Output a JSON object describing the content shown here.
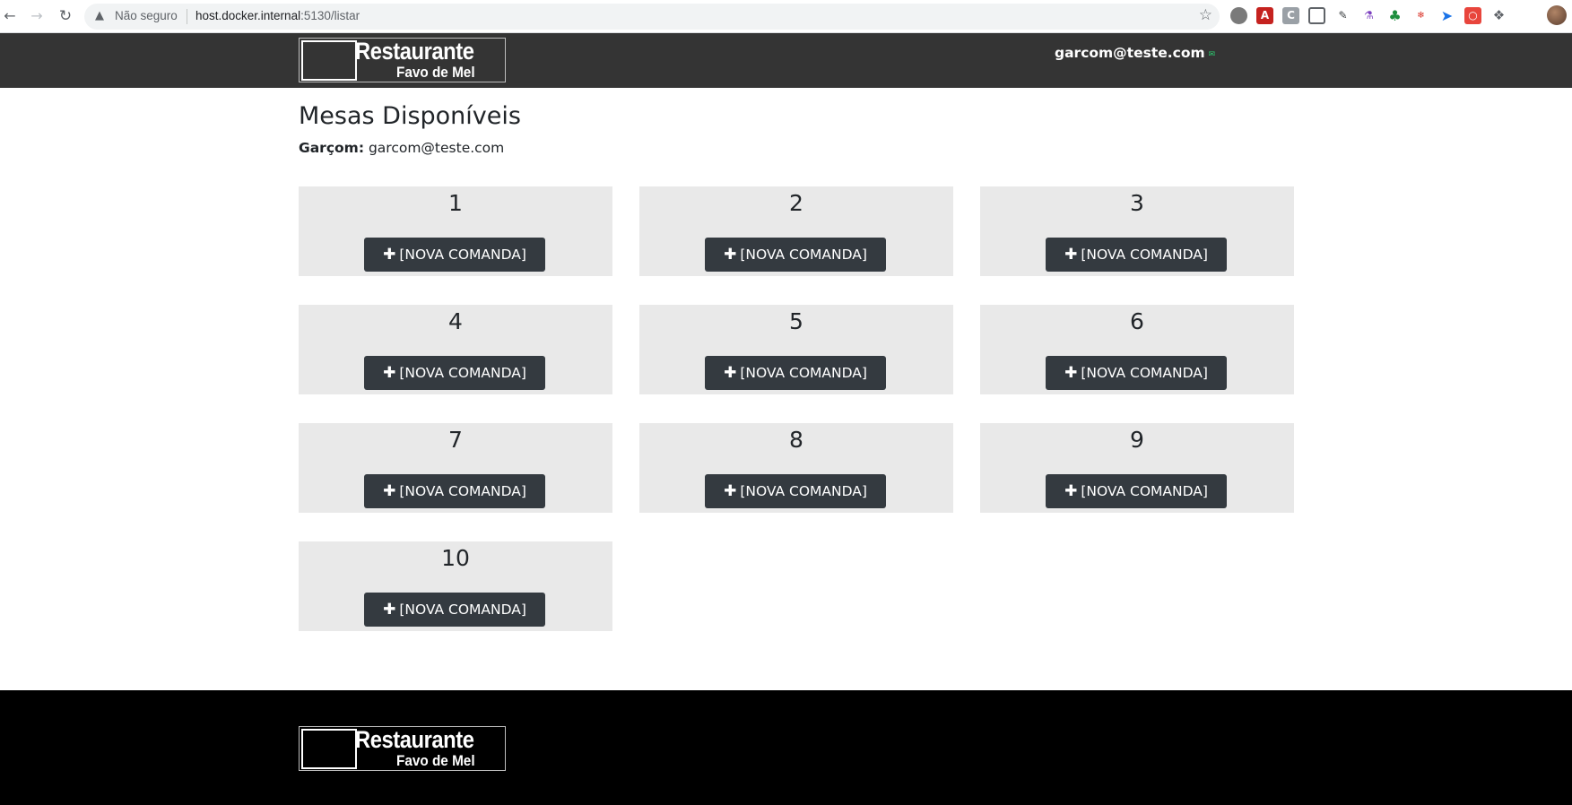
{
  "browser": {
    "nav_back_icon": "arrow-left-icon",
    "nav_forward_icon": "arrow-right-icon",
    "reload_icon": "reload-icon",
    "security_label": "Não seguro",
    "url_host": "host.docker.internal",
    "url_rest": ":5130/listar",
    "star_icon": "star-icon",
    "extensions": [
      "extension-1-icon",
      "pdf-extension-icon",
      "c-extension-icon",
      "grid-extension-icon",
      "pen-extension-icon",
      "flask-extension-icon",
      "tree-extension-icon",
      "react-extension-icon",
      "arrow-extension-icon",
      "camera-extension-icon",
      "puzzle-extension-icon"
    ],
    "profile_icon": "profile-avatar-icon"
  },
  "header": {
    "logo_title": "Restaurante",
    "logo_subtitle": "Favo de Mel",
    "user_email": "garcom@teste.com",
    "colors": {
      "bar": "#343434",
      "text": "#ffffff"
    }
  },
  "main": {
    "title": "Mesas Disponíveis",
    "waiter_label": "Garçom:",
    "waiter_email": "garcom@teste.com",
    "tables": [
      {
        "number": "1",
        "button_label": "[NOVA COMANDA]"
      },
      {
        "number": "2",
        "button_label": "[NOVA COMANDA]"
      },
      {
        "number": "3",
        "button_label": "[NOVA COMANDA]"
      },
      {
        "number": "4",
        "button_label": "[NOVA COMANDA]"
      },
      {
        "number": "5",
        "button_label": "[NOVA COMANDA]"
      },
      {
        "number": "6",
        "button_label": "[NOVA COMANDA]"
      },
      {
        "number": "7",
        "button_label": "[NOVA COMANDA]"
      },
      {
        "number": "8",
        "button_label": "[NOVA COMANDA]"
      },
      {
        "number": "9",
        "button_label": "[NOVA COMANDA]"
      },
      {
        "number": "10",
        "button_label": "[NOVA COMANDA]"
      }
    ],
    "colors": {
      "card": "#e9e9e9",
      "button": "#343a40"
    }
  },
  "footer": {
    "logo_title": "Restaurante",
    "logo_subtitle": "Favo de Mel",
    "colors": {
      "background": "#000000"
    }
  }
}
